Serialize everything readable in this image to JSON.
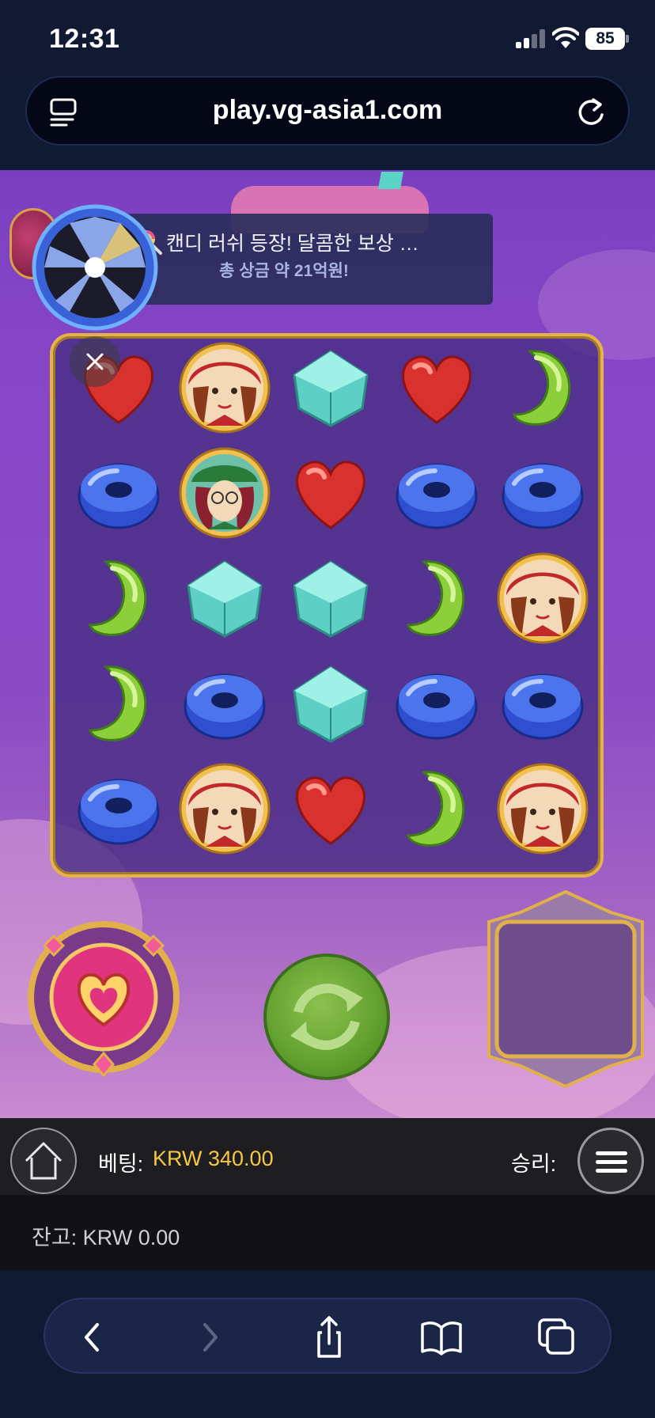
{
  "status_bar": {
    "time": "12:31",
    "battery": "85"
  },
  "browser": {
    "url": "play.vg-asia1.com"
  },
  "game": {
    "promo": {
      "line1": "캔디 러쉬 등장! 달콤한 보상 …",
      "line2": "총 상금 약 21억원!"
    },
    "grid": [
      [
        "red-heart",
        "red-hat-girl",
        "teal-gem",
        "red-heart",
        "green-bean"
      ],
      [
        "blue-ring",
        "green-hat-girl",
        "red-heart",
        "blue-ring",
        "blue-ring"
      ],
      [
        "green-bean",
        "teal-gem",
        "teal-gem",
        "green-bean",
        "red-hat-girl"
      ],
      [
        "green-bean",
        "blue-ring",
        "teal-gem",
        "blue-ring",
        "blue-ring"
      ],
      [
        "blue-ring",
        "red-hat-girl",
        "red-heart",
        "green-bean",
        "red-hat-girl"
      ]
    ],
    "colors": {
      "frame": "#e5b248",
      "bet_value": "#f5c841",
      "spin": "#7bb342"
    }
  },
  "bet_bar": {
    "bet_label": "베팅:",
    "bet_value": "KRW 340.00",
    "win_label": "승리:"
  },
  "balance_bar": {
    "balance": "잔고: KRW 0.00"
  }
}
